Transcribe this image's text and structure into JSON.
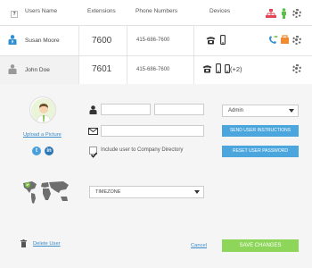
{
  "header": {
    "help_glyph": "?",
    "col_users": "Users Name",
    "col_extensions": "Extensions",
    "col_phones": "Phone Numbers",
    "col_devices": "Devices"
  },
  "rows": [
    {
      "name": "Susan Moore",
      "extension": "7600",
      "phone": "415-686-7600",
      "extra_devices": ""
    },
    {
      "name": "John Doe",
      "extension": "7601",
      "phone": "415-686-7600",
      "extra_devices": "(+2)"
    }
  ],
  "detail": {
    "upload_link": "Upload a Picture",
    "first_name_value": "",
    "last_name_value": "",
    "email_value": "",
    "include_directory_label": "Include user to Company Directory",
    "include_directory_checked": true,
    "role_selected": "Admin",
    "send_instructions_label": "SEND USER INSTRUCTIONS",
    "reset_password_label": "RESET USER PASSWORD",
    "timezone_selected": "TIMEZONE",
    "delete_label": "Delete User",
    "cancel_label": "Cancel",
    "save_label": "SAVE CHANGES"
  },
  "icons": {
    "help": "help-icon",
    "org_chart": "org-chart-icon",
    "person_green": "person-icon",
    "settings": "gear-icon",
    "desk_phone": "desk-phone-icon",
    "mobile": "mobile-icon",
    "trash": "trash-icon",
    "twitter": "twitter-icon",
    "linkedin": "linkedin-icon",
    "map": "world-map-icon"
  },
  "colors": {
    "accent_blue": "#4ba6de",
    "save_green": "#8ed65a",
    "link_blue": "#3a8cc8",
    "panel_bg": "#f5f5f5"
  }
}
